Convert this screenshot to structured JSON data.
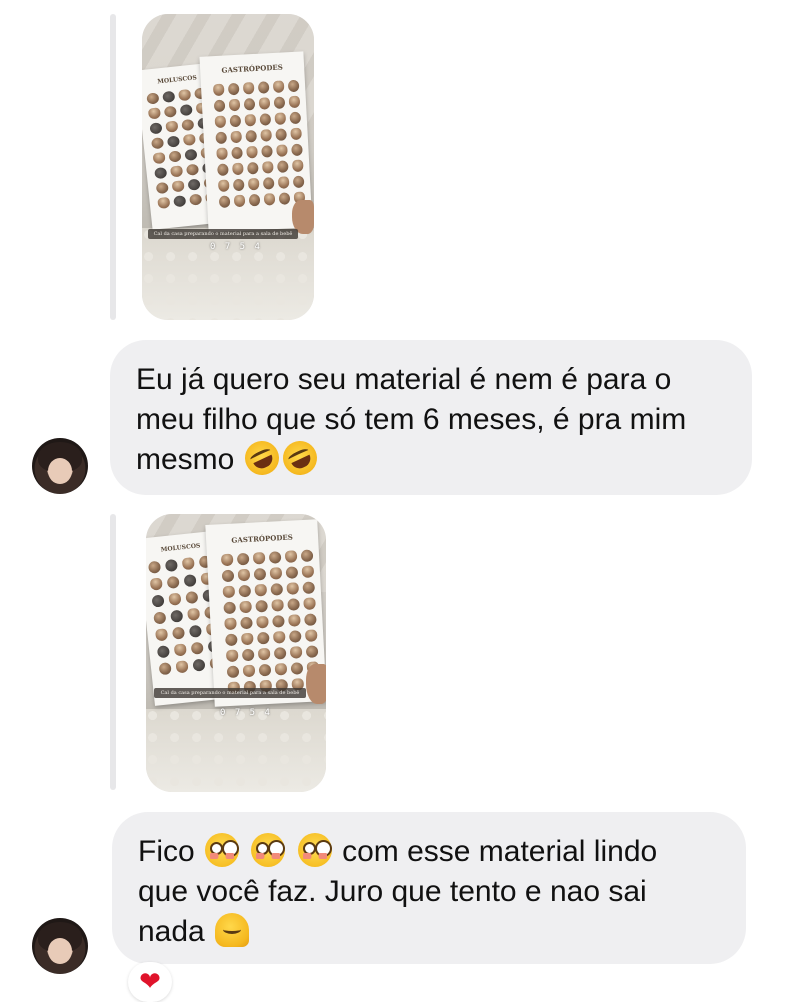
{
  "conversation": {
    "messages": [
      {
        "type": "story_reply",
        "story": {
          "paper_left_title": "MOLUSCOS",
          "paper_right_title": "GASTRÓPODES",
          "caption": "Cal da casa preparando o material para a sala de bebê",
          "timer": "0 7 5 4"
        },
        "text_lines": [
          "Eu já quero seu material é nem é para o",
          "meu filho que só tem 6 meses, é pra mim",
          "mesmo"
        ],
        "emojis": [
          "rolling-on-floor-laughing-emoji",
          "rolling-on-floor-laughing-emoji"
        ]
      },
      {
        "type": "story_reply",
        "story": {
          "paper_left_title": "MOLUSCOS",
          "paper_right_title": "GASTRÓPODES",
          "caption": "Cal da casa preparando o material para a sala de bebê",
          "timer": "0 7 5 4"
        },
        "text_line1_before": "Fico",
        "text_line1_after": "com esse material lindo",
        "text_line2": "que você faz. Juro que tento e nao sai",
        "text_line3": "nada",
        "reaction": "❤"
      }
    ]
  },
  "colors": {
    "bubble_bg": "#efeff1",
    "reply_bar": "#e7e7e9",
    "reaction_heart": "#e0132b"
  }
}
